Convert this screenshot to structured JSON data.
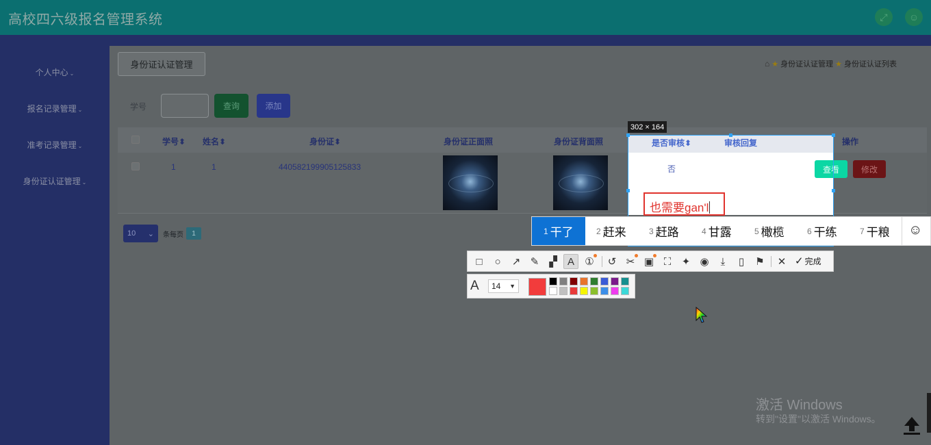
{
  "app": {
    "title": "高校四六级报名管理系统"
  },
  "header": {
    "fullscreen_icon": "expand-icon",
    "user_icon": "user-icon"
  },
  "sidebar": {
    "items": [
      {
        "label": "个人中心"
      },
      {
        "label": "报名记录管理"
      },
      {
        "label": "准考记录管理"
      },
      {
        "label": "身份证认证管理"
      }
    ]
  },
  "page": {
    "chip": "身份证认证管理",
    "breadcrumb": [
      "身份证认证管理",
      "身份证认证列表"
    ]
  },
  "search": {
    "label": "学号",
    "value": "",
    "query_label": "查询",
    "add_label": "添加"
  },
  "table": {
    "headers": [
      "学号",
      "姓名",
      "身份证",
      "身份证正面照",
      "身份证背面照",
      "是否审核",
      "审核回复",
      "操作"
    ],
    "sort_mark": "⬍",
    "rows": [
      {
        "student_id": "1",
        "name": "1",
        "id_card": "440582199905125833",
        "audited": "否",
        "reply": "",
        "view_label": "查看",
        "edit_label": "修改"
      }
    ]
  },
  "pager": {
    "page_size": "10",
    "per_page_text": "条每页",
    "current_page": "1"
  },
  "screenshot_tool": {
    "dimensions": "302 × 164",
    "text_annotation": "也需要",
    "text_annotation_pinyin": "gan'l",
    "ime_candidates": [
      {
        "n": "1",
        "text": "干了"
      },
      {
        "n": "2",
        "text": "赶来"
      },
      {
        "n": "3",
        "text": "赶路"
      },
      {
        "n": "4",
        "text": "甘露"
      },
      {
        "n": "5",
        "text": "橄榄"
      },
      {
        "n": "6",
        "text": "干练"
      },
      {
        "n": "7",
        "text": "干粮"
      }
    ],
    "done_label": "完成",
    "font_size": "14",
    "current_color": "#f23c3c",
    "palette_top": [
      "#000000",
      "#808080",
      "#800000",
      "#e8742c",
      "#2f7d2f",
      "#3b5bd6",
      "#7a1a8a",
      "#168f8f"
    ],
    "palette_bottom": [
      "#ffffff",
      "#c0c0c0",
      "#e83a3a",
      "#f4f400",
      "#8bbf2c",
      "#3c8ee8",
      "#ee3cee",
      "#3cd8d8"
    ]
  },
  "watermark": {
    "line1": "激活 Windows",
    "line2": "转到\"设置\"以激活 Windows。"
  }
}
